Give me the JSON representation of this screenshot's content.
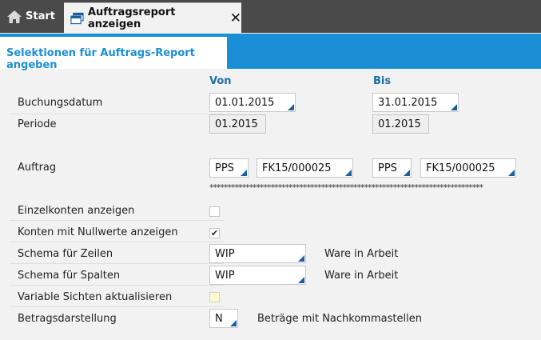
{
  "tabs": {
    "start_label": "Start",
    "active_label": "Auftragsreport anzeigen"
  },
  "section": {
    "title": "Selektionen für Auftrags-Report angeben"
  },
  "columns": {
    "from": "Von",
    "to": "Bis"
  },
  "fields": {
    "buchungsdatum": {
      "label": "Buchungsdatum",
      "from": "01.01.2015",
      "to": "31.01.2015"
    },
    "periode": {
      "label": "Periode",
      "from": "01.2015",
      "to": "01.2015"
    },
    "auftrag": {
      "label": "Auftrag",
      "from_prefix": "PPS",
      "from_value": "FK15/000025",
      "to_prefix": "PPS",
      "to_value": "FK15/000025",
      "mask": "****************************************************************************"
    },
    "einzelkonten": {
      "label": "Einzelkonten anzeigen",
      "checked": false
    },
    "nullwerte": {
      "label": "Konten mit Nullwerte anzeigen",
      "checked": true,
      "check_glyph": "✔"
    },
    "schema_zeilen": {
      "label": "Schema für Zeilen",
      "value": "WIP",
      "description": "Ware in Arbeit"
    },
    "schema_spalten": {
      "label": "Schema für Spalten",
      "value": "WIP",
      "description": "Ware in Arbeit"
    },
    "variable_sichten": {
      "label": "Variable Sichten aktualisieren",
      "checked": false
    },
    "betragsdarstellung": {
      "label": "Betragsdarstellung",
      "value": "N",
      "description": "Beträge mit Nachkommastellen"
    }
  },
  "colors": {
    "accent": "#1a8fd6",
    "tabbar": "#4a4a4a",
    "corner": "#1a5fa3"
  }
}
